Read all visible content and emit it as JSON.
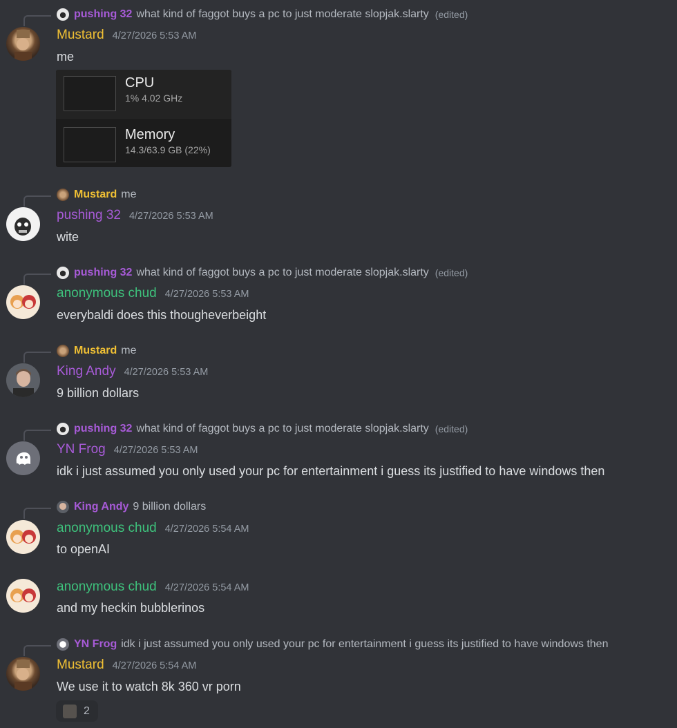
{
  "colors": {
    "background": "#313338",
    "purple_name": "#a85bd8",
    "green_name": "#3ec27c",
    "yellow_name": "#f0c034"
  },
  "messages": [
    {
      "reply": {
        "author": "pushing 32",
        "text": "what kind of faggot buys a pc to just moderate slopjak.slarty",
        "edited": "(edited)"
      },
      "author": "Mustard",
      "timestamp": "4/27/2026 5:53 AM",
      "content": "me",
      "embed": {
        "cpu_label": "CPU",
        "cpu_sub": "1%  4.02 GHz",
        "mem_label": "Memory",
        "mem_sub": "14.3/63.9 GB (22%)"
      }
    },
    {
      "reply": {
        "author": "Mustard",
        "text": "me"
      },
      "author": "pushing 32",
      "timestamp": "4/27/2026 5:53 AM",
      "content": "wite"
    },
    {
      "reply": {
        "author": "pushing 32",
        "text": "what kind of faggot buys a pc to just moderate slopjak.slarty",
        "edited": "(edited)"
      },
      "author": "anonymous chud",
      "timestamp": "4/27/2026 5:53 AM",
      "content": "everybaldi does this thougheverbeight"
    },
    {
      "reply": {
        "author": "Mustard",
        "text": "me"
      },
      "author": "King Andy",
      "timestamp": "4/27/2026 5:53 AM",
      "content": "9 billion dollars"
    },
    {
      "reply": {
        "author": "pushing 32",
        "text": "what kind of faggot buys a pc to just moderate slopjak.slarty",
        "edited": "(edited)"
      },
      "author": "YN Frog",
      "timestamp": "4/27/2026 5:53 AM",
      "content": "idk i just assumed you only used your pc for entertainment i guess its justified to have windows then"
    },
    {
      "reply": {
        "author": "King Andy",
        "text": "9 billion dollars"
      },
      "author": "anonymous chud",
      "timestamp": "4/27/2026 5:54 AM",
      "content": "to openAI"
    },
    {
      "author": "anonymous chud",
      "timestamp": "4/27/2026 5:54 AM",
      "content": "and my heckin bubblerinos"
    },
    {
      "reply": {
        "author": "YN Frog",
        "text": "idk i just assumed you only used your pc for entertainment i guess its justified to have windows then"
      },
      "author": "Mustard",
      "timestamp": "4/27/2026 5:54 AM",
      "content": "We use it to watch 8k 360 vr porn",
      "reaction": {
        "count": "2"
      }
    }
  ]
}
